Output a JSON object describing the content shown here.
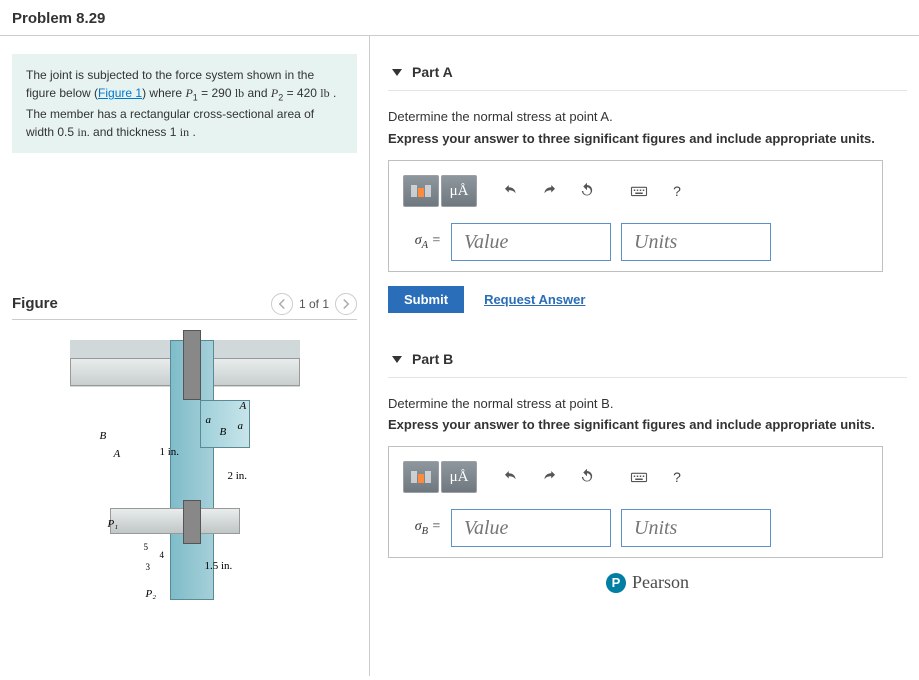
{
  "header": {
    "title": "Problem 8.29"
  },
  "statement": {
    "prefix": "The joint is subjected to the force system shown in the figure below (",
    "figure_link": "Figure 1",
    "mid1": ") where ",
    "p1_var": "P",
    "p1_sub": "1",
    "p1_eq": " = 290 ",
    "p1_unit": "lb",
    "mid2": " and ",
    "p2_var": "P",
    "p2_sub": "2",
    "p2_eq": " = 420 ",
    "p2_unit": "lb",
    "mid3": " . The member has a rectangular cross-sectional area of width 0.5 ",
    "w_unit": "in.",
    "mid4": " and thickness 1 ",
    "t_unit": "in",
    "tail": " ."
  },
  "figure": {
    "title": "Figure",
    "counter": "1 of 1",
    "labels": {
      "A": "A",
      "B": "B",
      "BArrow": "B",
      "a1": "a",
      "a2": "a",
      "one_in": "1 in.",
      "two_in": "2 in.",
      "onefive_in": "1.5 in.",
      "P1": "P₁",
      "P2": "P₂",
      "ang1": "5",
      "ang2": "4",
      "ang3": "3"
    }
  },
  "partA": {
    "title": "Part A",
    "prompt": "Determine the normal stress at point A.",
    "instruction": "Express your answer to three significant figures and include appropriate units.",
    "eq_label": "σA =",
    "value_placeholder": "Value",
    "units_placeholder": "Units",
    "submit": "Submit",
    "request": "Request Answer",
    "mu": "μÅ"
  },
  "partB": {
    "title": "Part B",
    "prompt": "Determine the normal stress at point B.",
    "instruction": "Express your answer to three significant figures and include appropriate units.",
    "eq_label": "σB =",
    "value_placeholder": "Value",
    "units_placeholder": "Units",
    "mu": "μÅ"
  },
  "toolbar": {
    "help": "?"
  },
  "footer": {
    "brand": "Pearson"
  }
}
